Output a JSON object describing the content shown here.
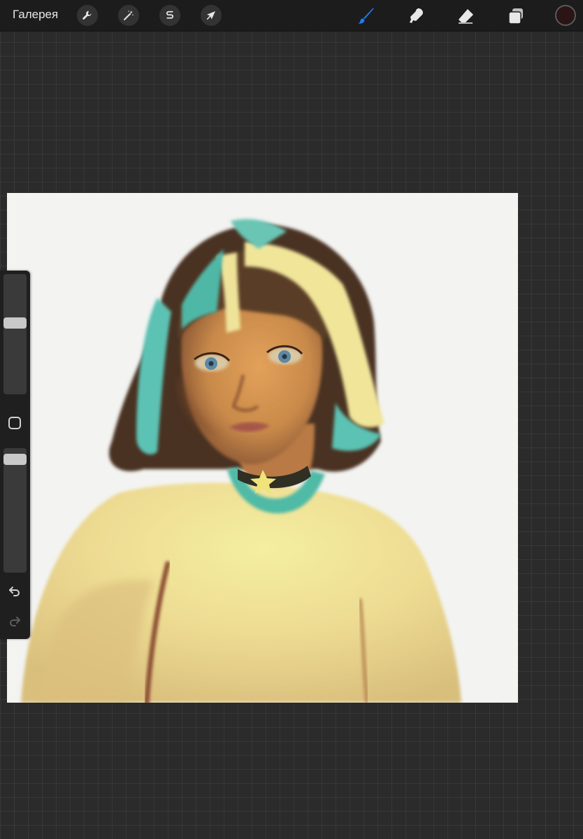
{
  "toolbar": {
    "gallery_label": "Галерея",
    "left_tools": [
      {
        "icon": "wrench-icon",
        "name": "actions"
      },
      {
        "icon": "magic-wand-icon",
        "name": "adjustments"
      },
      {
        "icon": "selection-s-icon",
        "name": "selection"
      },
      {
        "icon": "arrow-cursor-icon",
        "name": "transform"
      }
    ],
    "right_tools": [
      {
        "icon": "brush-icon",
        "name": "paint",
        "active": true
      },
      {
        "icon": "smudge-finger-icon",
        "name": "smudge",
        "active": false
      },
      {
        "icon": "eraser-icon",
        "name": "erase",
        "active": false
      },
      {
        "icon": "layers-icon",
        "name": "layers",
        "active": false
      }
    ],
    "current_color": "#2a1414",
    "accent_color": "#1e7cf2"
  },
  "sidebar": {
    "brush_size_value": 0.6,
    "opacity_value": 0.95,
    "modify_icon": "square-modify-icon",
    "undo_icon": "undo-icon",
    "redo_icon": "redo-icon",
    "redo_enabled": false
  },
  "canvas": {
    "background_color": "#f3f3f1",
    "artwork": "painted-portrait"
  }
}
